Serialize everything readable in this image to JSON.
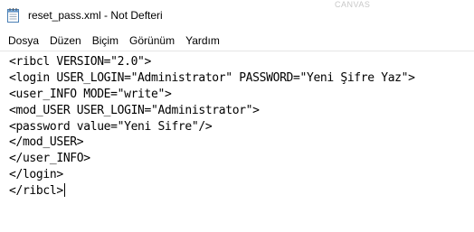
{
  "window": {
    "title": "reset_pass.xml - Not Defteri",
    "background_caption": "CANVAS"
  },
  "menu": {
    "items": [
      {
        "id": "dosya",
        "label": "Dosya"
      },
      {
        "id": "duzen",
        "label": "Düzen"
      },
      {
        "id": "bicim",
        "label": "Biçim"
      },
      {
        "id": "gorunum",
        "label": "Görünüm"
      },
      {
        "id": "yardim",
        "label": "Yardım"
      }
    ]
  },
  "editor": {
    "lines": [
      "<ribcl VERSION=\"2.0\">",
      "<login USER_LOGIN=\"Administrator\" PASSWORD=\"Yeni Şifre Yaz\">",
      "<user_INFO MODE=\"write\">",
      "<mod_USER USER_LOGIN=\"Administrator\">",
      "<password value=\"Yeni Sifre\"/>",
      "</mod_USER>",
      "</user_INFO>",
      "</login>",
      "</ribcl>"
    ]
  },
  "icons": {
    "app": "notepad-icon"
  },
  "colors": {
    "background": "#ffffff",
    "text": "#000000",
    "separator": "#e6e6e6"
  }
}
